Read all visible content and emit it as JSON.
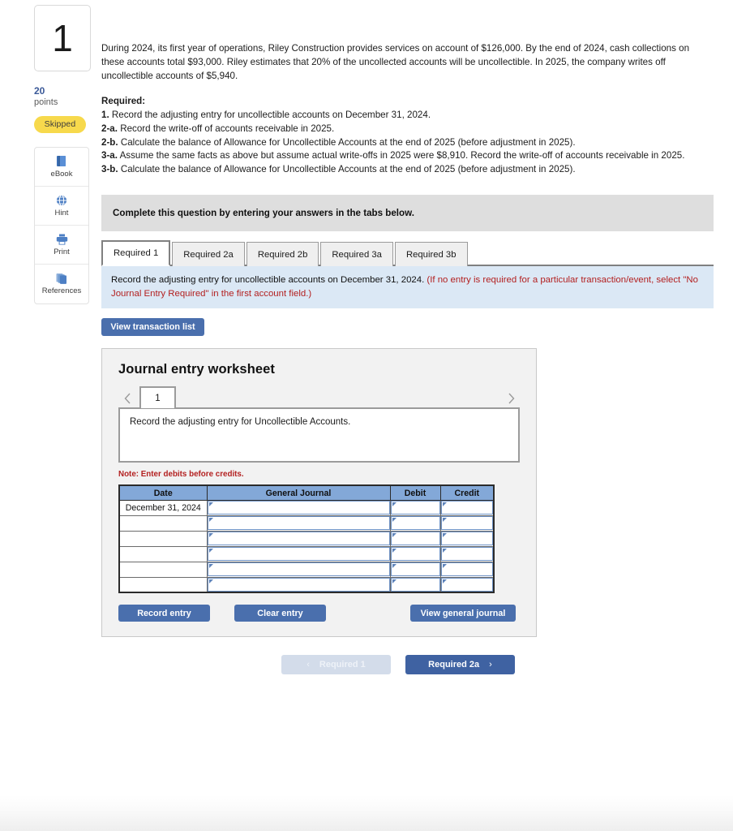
{
  "sidebar": {
    "question_number": "1",
    "points_value": "20",
    "points_label": "points",
    "status_badge": "Skipped",
    "tools": [
      {
        "name": "ebook",
        "label": "eBook"
      },
      {
        "name": "hint",
        "label": "Hint"
      },
      {
        "name": "print",
        "label": "Print"
      },
      {
        "name": "references",
        "label": "References"
      }
    ]
  },
  "question": {
    "paragraph": "During 2024, its first year of operations, Riley Construction provides services on account of $126,000. By the end of 2024, cash collections on these accounts total $93,000. Riley estimates that 20% of the uncollected accounts will be uncollectible. In 2025, the company writes off uncollectible accounts of $5,940.",
    "required_heading": "Required:",
    "requirements": [
      {
        "num": "1.",
        "text": "Record the adjusting entry for uncollectible accounts on December 31, 2024."
      },
      {
        "num": "2-a.",
        "text": "Record the write-off of accounts receivable in 2025."
      },
      {
        "num": "2-b.",
        "text": "Calculate the balance of Allowance for Uncollectible Accounts at the end of 2025 (before adjustment in 2025)."
      },
      {
        "num": "3-a.",
        "text": "Assume the same facts as above but assume actual write-offs in 2025 were $8,910. Record the write-off of accounts receivable in 2025."
      },
      {
        "num": "3-b.",
        "text": "Calculate the balance of Allowance for Uncollectible Accounts at the end of 2025 (before adjustment in 2025)."
      }
    ]
  },
  "notice": "Complete this question by entering your answers in the tabs below.",
  "tabs": [
    {
      "label": "Required 1",
      "active": true
    },
    {
      "label": "Required 2a",
      "active": false
    },
    {
      "label": "Required 2b",
      "active": false
    },
    {
      "label": "Required 3a",
      "active": false
    },
    {
      "label": "Required 3b",
      "active": false
    }
  ],
  "prompt": {
    "main": "Record the adjusting entry for uncollectible accounts on December 31, 2024.",
    "hint": "(If no entry is required for a particular transaction/event, select \"No Journal Entry Required\" in the first account field.)"
  },
  "view_transaction_list_label": "View transaction list",
  "worksheet": {
    "title": "Journal entry worksheet",
    "page_tab": "1",
    "prev_icon": "chevron-left-icon",
    "next_icon": "chevron-right-icon",
    "description": "Record the adjusting entry for Uncollectible Accounts.",
    "note": "Note: Enter debits before credits.",
    "table": {
      "headers": [
        "Date",
        "General Journal",
        "Debit",
        "Credit"
      ],
      "rows": [
        {
          "date": "December 31, 2024",
          "general_journal": "",
          "debit": "",
          "credit": ""
        },
        {
          "date": "",
          "general_journal": "",
          "debit": "",
          "credit": ""
        },
        {
          "date": "",
          "general_journal": "",
          "debit": "",
          "credit": ""
        },
        {
          "date": "",
          "general_journal": "",
          "debit": "",
          "credit": ""
        },
        {
          "date": "",
          "general_journal": "",
          "debit": "",
          "credit": ""
        },
        {
          "date": "",
          "general_journal": "",
          "debit": "",
          "credit": ""
        }
      ]
    },
    "buttons": {
      "record": "Record entry",
      "clear": "Clear entry",
      "view_general_journal": "View general journal"
    }
  },
  "bottom_nav": {
    "prev_label": "Required 1",
    "next_label": "Required 2a",
    "prev_icon": "chevron-left-icon",
    "next_icon": "chevron-right-icon"
  },
  "colors": {
    "accent_blue": "#4a6fad",
    "nav_next": "#3f62a2",
    "prompt_bg": "#dbe8f5",
    "notice_bg": "#dedede",
    "badge_yellow": "#f7d94c",
    "table_header": "#83a8d8",
    "red_text": "#b32020"
  }
}
